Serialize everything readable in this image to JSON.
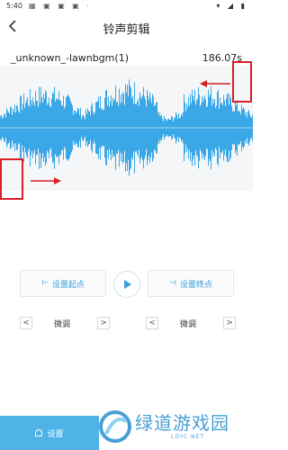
{
  "status_bar": {
    "time": "5:40",
    "notif_icons": "▦ ▣ ▣ ▣ ·",
    "right_icons": "▾ ◢ ▮"
  },
  "header": {
    "title": "铃声剪辑"
  },
  "track": {
    "name": "_unknown_-lawnbgm(1)",
    "duration": "186.07s"
  },
  "controls": {
    "set_start_label": "设置起点",
    "set_end_label": "设置终点",
    "fine_tune_left": "微调",
    "fine_tune_right": "微调",
    "prev_symbol": "<",
    "next_symbol": ">"
  },
  "bottom": {
    "settings_label": "设置"
  },
  "watermark": {
    "main": "绿道游戏园",
    "sub": "LDYC.NET"
  },
  "colors": {
    "waveform": "#3aa8e6",
    "accent": "#3a9fd8",
    "marker": "#d81f26",
    "bottom_button": "#4fb3e8"
  }
}
